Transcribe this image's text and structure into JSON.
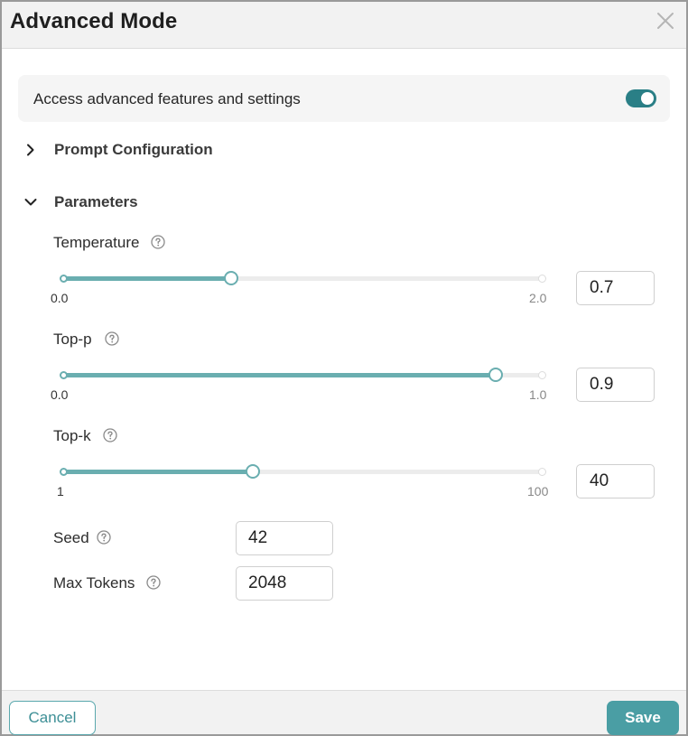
{
  "dialog": {
    "title": "Advanced Mode",
    "close_icon": "close-icon"
  },
  "advanced_toggle": {
    "label": "Access advanced features and settings",
    "enabled": true,
    "color": "#2a7f86"
  },
  "sections": {
    "prompt_configuration": {
      "label": "Prompt Configuration",
      "expanded": false
    },
    "parameters": {
      "label": "Parameters",
      "expanded": true
    }
  },
  "parameters": {
    "temperature": {
      "label": "Temperature",
      "min_label": "0.0",
      "max_label": "2.0",
      "min": 0.0,
      "max": 2.0,
      "value": "0.7"
    },
    "top_p": {
      "label": "Top-p",
      "min_label": "0.0",
      "max_label": "1.0",
      "min": 0.0,
      "max": 1.0,
      "value": "0.9"
    },
    "top_k": {
      "label": "Top-k",
      "min_label": "1",
      "max_label": "100",
      "min": 1,
      "max": 100,
      "value": "40"
    },
    "seed": {
      "label": "Seed",
      "value": "42"
    },
    "max_tokens": {
      "label": "Max Tokens",
      "value": "2048"
    }
  },
  "footer": {
    "cancel_label": "Cancel",
    "save_label": "Save"
  },
  "colors": {
    "accent": "#4a9ea4",
    "slider_fill": "#6aaeb0"
  }
}
